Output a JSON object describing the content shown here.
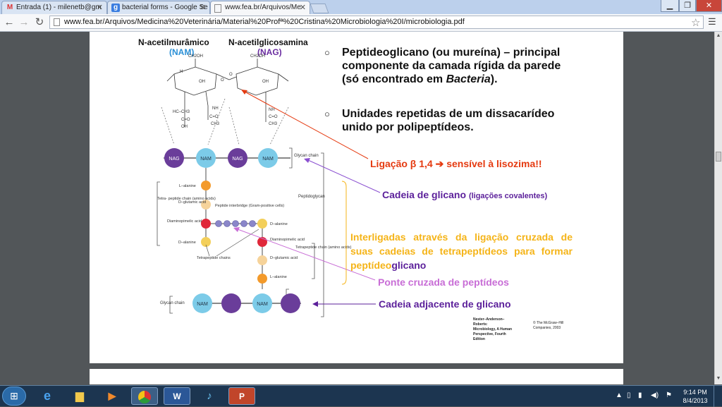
{
  "browser": {
    "tabs": [
      {
        "label": "Entrada (1) - milenetb@gm",
        "icon": "gmail-icon",
        "active": false
      },
      {
        "label": "bacterial forms - Google Se",
        "icon": "google-icon",
        "active": false
      },
      {
        "label": "www.fea.br/Arquivos/Me",
        "icon": "page-icon",
        "active": true
      }
    ],
    "url_host": "www.fea.br",
    "url_path": "/Arquivos/Medicina%20Veterin%C3%A1ria/Material%20Prof%C2%AA%20Cristina%20Microbiologia%20I/microbiologia.pdf",
    "url_display": "www.fea.br/Arquivos/Medicina%20Veterinária/Material%20Profª%20Cristina%20Microbiologia%20I/microbiologia.pdf"
  },
  "slide": {
    "nam_name": "N-acetilmurâmico",
    "nam_abbr": "(NAM)",
    "nag_name": "N-acetilglicosamina",
    "nag_abbr": "(NAG)",
    "bullet1_a": "Peptideoglicano (ou mureína) – principal componente da camada rígida da parede (só encontrado em ",
    "bullet1_italic": "Bacteria",
    "bullet1_b": ").",
    "bullet2": "Unidades repetidas de um dissacarídeo unido por polipeptídeos.",
    "ligacao": "Ligação β 1,4 ➔  sensível à lisozima!!",
    "cadeia_glicano": "Cadeia de glicano",
    "cadeia_glicano_note": "(ligações covalentes)",
    "interligadas": "Interligadas através da ligação cruzada de suas cadeias de tetrapeptídeos para formar peptídeo",
    "interligadas_end": "glicano",
    "ponte": "Ponte cruzada de peptídeos",
    "cadeia_adjacente": "Cadeia adjacente de glicano",
    "credit_left": [
      "Nester–Anderson–Roberts:",
      "Microbiology, A Human",
      "Perspective, Fourth Edition"
    ],
    "credit_right": [
      "© The McGraw–Hill",
      "Companies, 2003"
    ]
  },
  "diagram": {
    "nag": "NAG",
    "nam": "NAM",
    "glycan_chain": "Glycan chain",
    "peptidoglycan": "Peptidoglycan",
    "l_alanine": "L–alanine",
    "d_glutamic": "D–glutamic acid",
    "diaminopimelic": "Diaminopimelic acid",
    "d_alanine": "D–alanine",
    "tetra_chain": "Tetra- peptide chain (amino acids)",
    "interbridge": "Peptide interbridge (Gram-positive cells)",
    "tetrapeptide_chain": "Tetrapeptide chain (amino acids)",
    "tetrapeptide_chains": "Tetrapeptide chains"
  },
  "taskbar": {
    "apps": [
      "explorer",
      "ie",
      "folder",
      "media",
      "chrome",
      "word",
      "itunes",
      "powerpoint"
    ],
    "time": "9:14 PM",
    "date": "8/4/2013"
  },
  "colors": {
    "nag": "#6a3d9a",
    "nam": "#7ccbe8",
    "red_text": "#e53a10",
    "purple_text": "#5b1f9a",
    "yellow_text": "#f5b418",
    "pink_text": "#c86dd6",
    "orange_ball": "#f39a2b",
    "red_ball": "#e0283a",
    "pale_ball": "#f6d39a",
    "bridge_ball": "#8a86c9"
  }
}
